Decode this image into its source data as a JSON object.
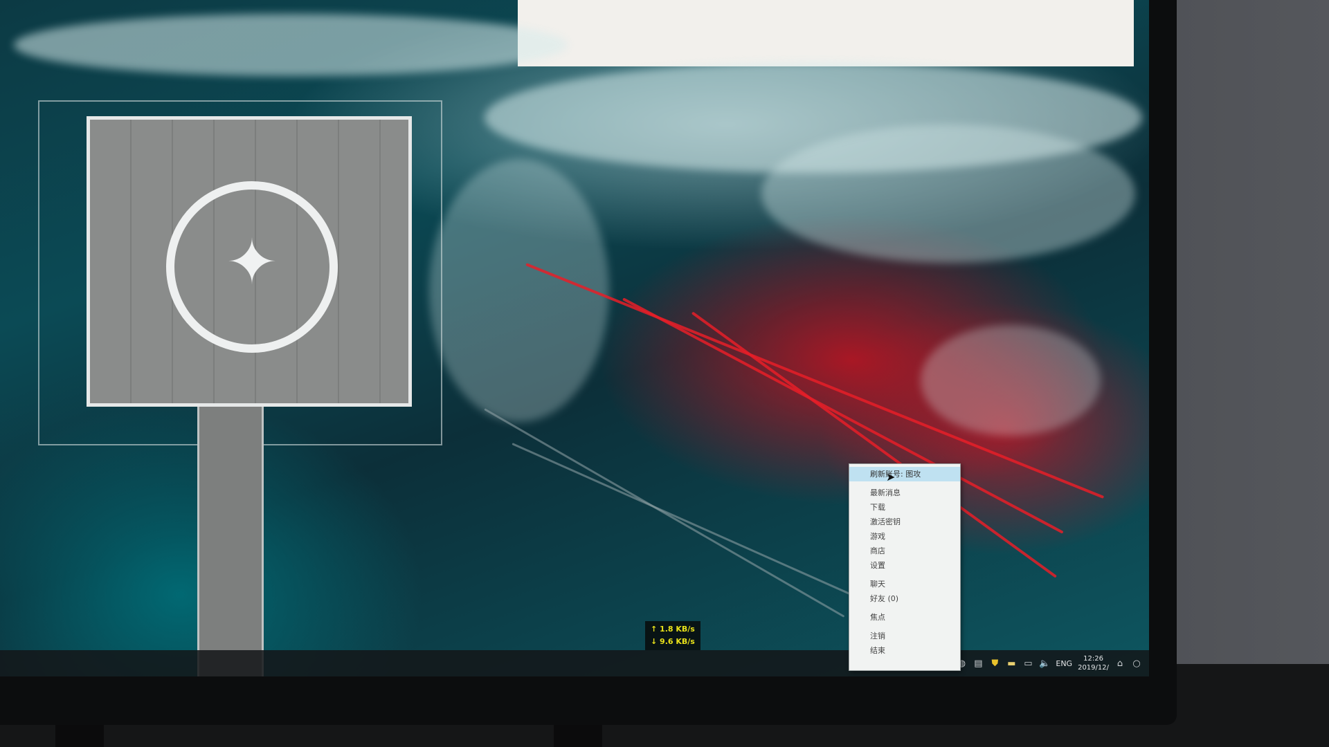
{
  "context_menu": {
    "items": [
      {
        "label": "刷新账号: 图攻",
        "active": true
      },
      {
        "label": "最新消息"
      },
      {
        "label": "下载"
      },
      {
        "label": "激活密钥"
      },
      {
        "label": "游戏"
      },
      {
        "label": "商店"
      },
      {
        "label": "设置"
      },
      {
        "label": "聊天"
      },
      {
        "label": "好友 (0)"
      },
      {
        "label": "焦点"
      },
      {
        "label": "注销"
      },
      {
        "label": "结束"
      }
    ]
  },
  "network_meter": {
    "upload": "↑ 1.8 KB/s",
    "download": "↓ 9.6 KB/s"
  },
  "taskbar": {
    "language": "ENG",
    "clock_time": "12:26",
    "clock_date": "2019/12/"
  },
  "colors": {
    "menu_highlight": "#bfe1f1",
    "net_text": "#e9e21a",
    "taskbar": "#141618"
  }
}
